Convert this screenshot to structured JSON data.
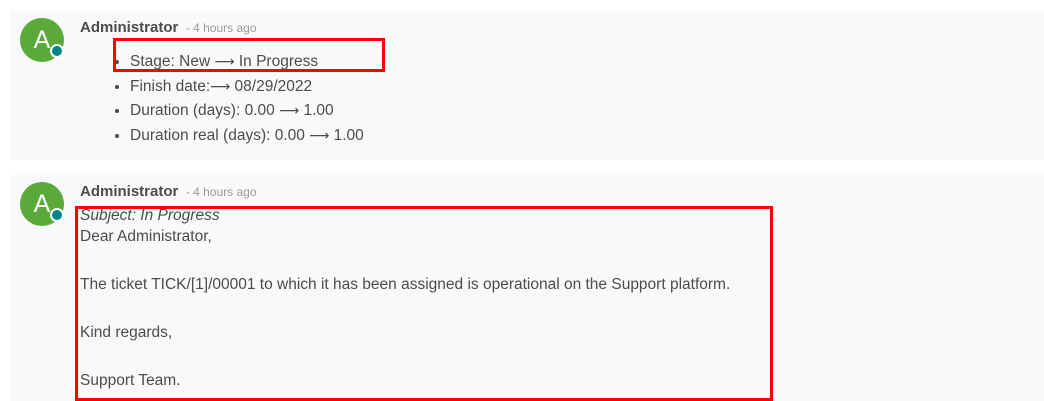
{
  "messages": [
    {
      "avatar_letter": "A",
      "author": "Administrator",
      "date": "- 4 hours ago",
      "tracking": [
        {
          "label": "Stage:",
          "old": "New",
          "arrow": "⟶",
          "new": "In Progress"
        },
        {
          "label": "Finish date:",
          "old": "",
          "arrow": "⟶",
          "new": "08/29/2022"
        },
        {
          "label": "Duration (days):",
          "old": "0.00",
          "arrow": "⟶",
          "new": "1.00"
        },
        {
          "label": "Duration real (days):",
          "old": "0.00",
          "arrow": "⟶",
          "new": "1.00"
        }
      ]
    },
    {
      "avatar_letter": "A",
      "author": "Administrator",
      "date": "- 4 hours ago",
      "subject": "Subject: In Progress",
      "greeting": "Dear Administrator,",
      "body_before": "The ticket ",
      "ticket_ref": "TICK/[1]/00001",
      "body_after": " to which it has been assigned is operational on the Support platform.",
      "closing": "Kind regards,",
      "signature": "Support Team."
    }
  ],
  "colors": {
    "avatar_bg": "#5aaa3a",
    "presence": "#00848a",
    "highlight": "#ff0000",
    "message_bg": "#f8f9fb"
  }
}
